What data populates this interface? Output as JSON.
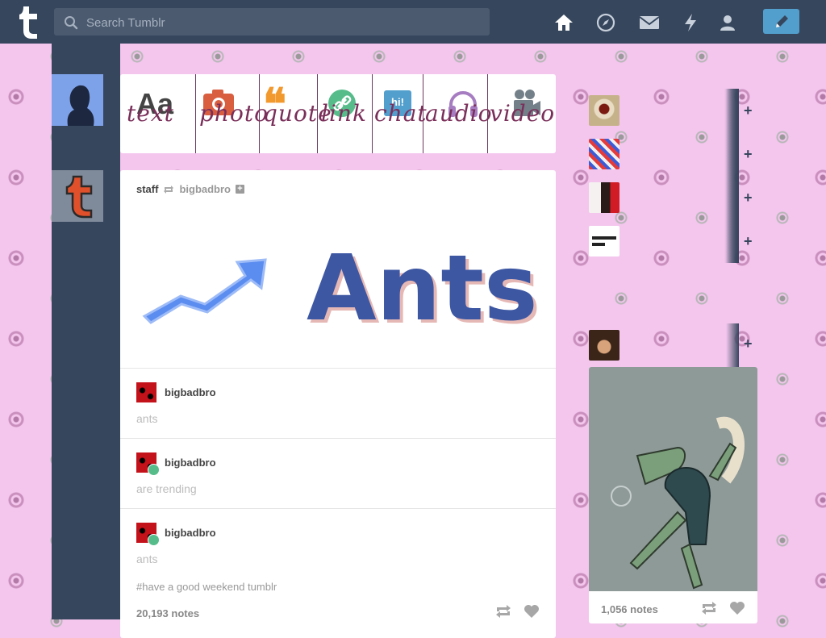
{
  "header": {
    "logo_letter": "t",
    "search_placeholder": "Search Tumblr",
    "nav_icons": [
      "home-icon",
      "explore-icon",
      "inbox-icon",
      "activity-icon",
      "account-icon"
    ],
    "compose_icon": "pencil-icon"
  },
  "post_types": [
    {
      "label": "text",
      "glyph": "Aa",
      "icon": "text-icon",
      "color": "#444444"
    },
    {
      "label": "photo",
      "icon": "camera-icon",
      "color": "#d95e40"
    },
    {
      "label": "quote",
      "glyph": "❝",
      "icon": "quote-icon",
      "color": "#f2992e"
    },
    {
      "label": "link",
      "icon": "link-icon",
      "color": "#56bc8a"
    },
    {
      "label": "chat",
      "glyph": "hi!",
      "icon": "chat-icon",
      "color": "#529ecc"
    },
    {
      "label": "audio",
      "icon": "headphones-icon",
      "color": "#a77dc2"
    },
    {
      "label": "video",
      "icon": "video-camera-icon",
      "color": "#748089"
    }
  ],
  "post": {
    "author": "staff",
    "reblogged_from": "bigbadbro",
    "banner_text": "Ants",
    "chain": [
      {
        "name": "bigbadbro",
        "text": "ants",
        "reblog": false
      },
      {
        "name": "bigbadbro",
        "text": "are trending",
        "reblog": true
      },
      {
        "name": "bigbadbro",
        "text": "ants",
        "reblog": true
      }
    ],
    "tags": "#have a good weekend tumblr",
    "notes": "20,193 notes"
  },
  "sidebar": {
    "radar_notes": "1,056 notes"
  },
  "colors": {
    "nav_bg": "#36465d",
    "accent_blue": "#529ecc",
    "page_bg": "#f4c6ee",
    "script": "#7a2f5a"
  }
}
